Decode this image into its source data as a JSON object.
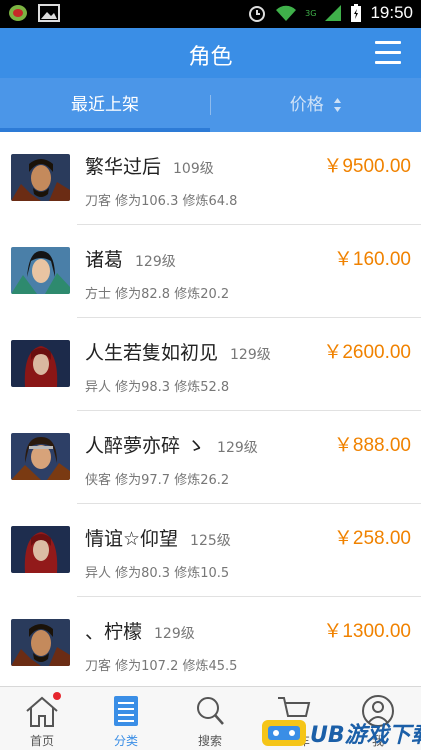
{
  "status_bar": {
    "time": "19:50",
    "network_label": "3G"
  },
  "header": {
    "title": "角色"
  },
  "tabs": {
    "recent_label": "最近上架",
    "price_label": "价格"
  },
  "items": [
    {
      "name": "繁华过后",
      "level": "109级",
      "detail": "刀客 修为106.3 修炼64.8",
      "price": "￥9500.00"
    },
    {
      "name": "诸葛",
      "level": "129级",
      "detail": "方士 修为82.8 修炼20.2",
      "price": "￥160.00"
    },
    {
      "name": "人生若隻如初见",
      "level": "129级",
      "detail": "异人 修为98.3 修炼52.8",
      "price": "￥2600.00"
    },
    {
      "name": "人醉夢亦碎 ゝ",
      "level": "129级",
      "detail": "侠客 修为97.7 修炼26.2",
      "price": "￥888.00"
    },
    {
      "name": "情谊☆仰望",
      "level": "125级",
      "detail": "异人 修为80.3 修炼10.5",
      "price": "￥258.00"
    },
    {
      "name": "、柠檬",
      "level": "129级",
      "detail": "刀客 修为107.2 修炼45.5",
      "price": "￥1300.00"
    }
  ],
  "bottom_nav": {
    "home": "首页",
    "category": "分类",
    "search": "搜索",
    "cart": "车",
    "me": "我"
  },
  "watermark": {
    "text": "UB游戏下载"
  },
  "colors": {
    "primary": "#3a8ee6",
    "price": "#f08200"
  }
}
